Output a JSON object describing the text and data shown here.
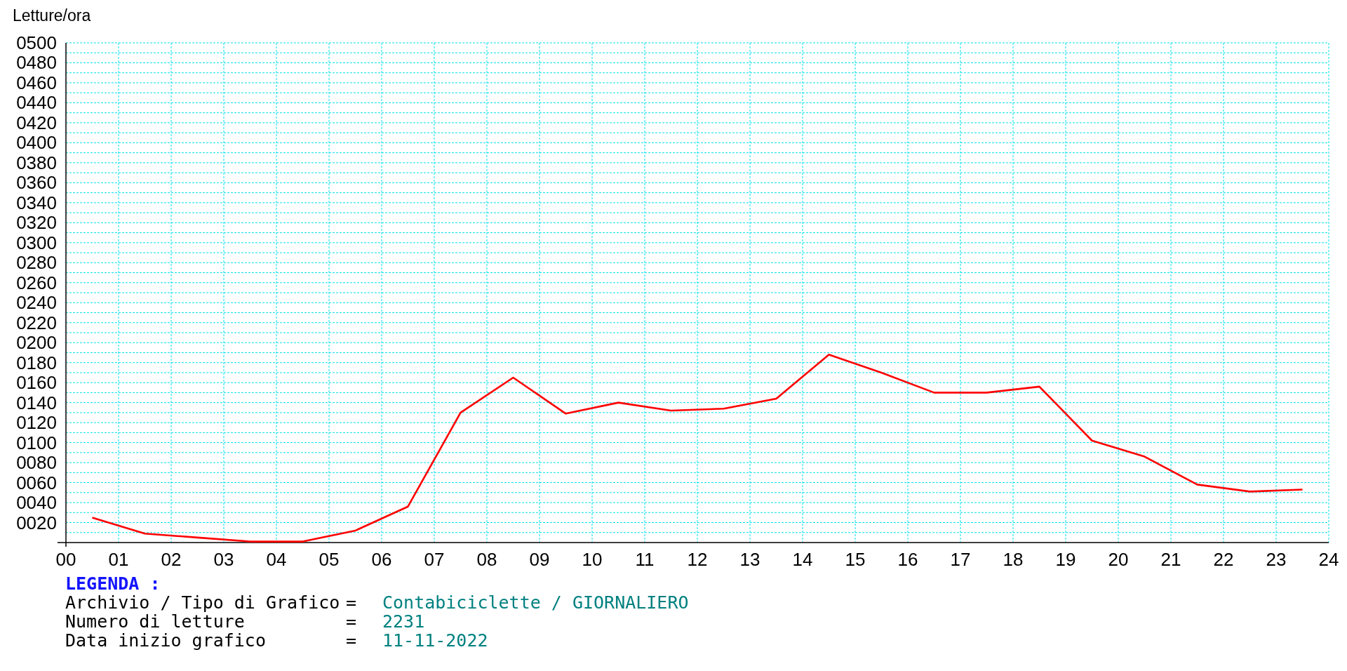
{
  "chart": {
    "chart_data": {
      "type": "line",
      "grid": true,
      "ylabel": "Letture/ora",
      "x": [
        0.5,
        1.5,
        2.5,
        3.5,
        4.5,
        5.5,
        6.5,
        7.5,
        8.5,
        9.5,
        10.5,
        11.5,
        12.5,
        13.5,
        14.5,
        15.5,
        16.5,
        17.5,
        18.5,
        19.5,
        20.5,
        21.5,
        22.5,
        23.5
      ],
      "series": [
        {
          "color": "#ff0000",
          "values": [
            25,
            9,
            5,
            1,
            1,
            12,
            36,
            130,
            165,
            129,
            140,
            132,
            134,
            144,
            188,
            170,
            150,
            150,
            156,
            102,
            86,
            58,
            51,
            53
          ]
        }
      ],
      "xlim": [
        0,
        24
      ],
      "ylim": [
        0,
        500
      ],
      "xticks": [
        {
          "value": 0,
          "label": "00"
        },
        {
          "value": 1,
          "label": "01"
        },
        {
          "value": 2,
          "label": "02"
        },
        {
          "value": 3,
          "label": "03"
        },
        {
          "value": 4,
          "label": "04"
        },
        {
          "value": 5,
          "label": "05"
        },
        {
          "value": 6,
          "label": "06"
        },
        {
          "value": 7,
          "label": "07"
        },
        {
          "value": 8,
          "label": "08"
        },
        {
          "value": 9,
          "label": "09"
        },
        {
          "value": 10,
          "label": "10"
        },
        {
          "value": 11,
          "label": "11"
        },
        {
          "value": 12,
          "label": "12"
        },
        {
          "value": 13,
          "label": "13"
        },
        {
          "value": 14,
          "label": "14"
        },
        {
          "value": 15,
          "label": "15"
        },
        {
          "value": 16,
          "label": "16"
        },
        {
          "value": 17,
          "label": "17"
        },
        {
          "value": 18,
          "label": "18"
        },
        {
          "value": 19,
          "label": "19"
        },
        {
          "value": 20,
          "label": "20"
        },
        {
          "value": 21,
          "label": "21"
        },
        {
          "value": 22,
          "label": "22"
        },
        {
          "value": 23,
          "label": "23"
        },
        {
          "value": 24,
          "label": "24"
        }
      ],
      "yticks": [
        {
          "value": 20,
          "label": "0020"
        },
        {
          "value": 40,
          "label": "0040"
        },
        {
          "value": 60,
          "label": "0060"
        },
        {
          "value": 80,
          "label": "0080"
        },
        {
          "value": 100,
          "label": "0100"
        },
        {
          "value": 120,
          "label": "0120"
        },
        {
          "value": 140,
          "label": "0140"
        },
        {
          "value": 160,
          "label": "0160"
        },
        {
          "value": 180,
          "label": "0180"
        },
        {
          "value": 200,
          "label": "0200"
        },
        {
          "value": 220,
          "label": "0220"
        },
        {
          "value": 240,
          "label": "0240"
        },
        {
          "value": 260,
          "label": "0260"
        },
        {
          "value": 280,
          "label": "0280"
        },
        {
          "value": 300,
          "label": "0300"
        },
        {
          "value": 320,
          "label": "0320"
        },
        {
          "value": 340,
          "label": "0340"
        },
        {
          "value": 360,
          "label": "0360"
        },
        {
          "value": 380,
          "label": "0380"
        },
        {
          "value": 400,
          "label": "0400"
        },
        {
          "value": 420,
          "label": "0420"
        },
        {
          "value": 440,
          "label": "0440"
        },
        {
          "value": 460,
          "label": "0460"
        },
        {
          "value": 480,
          "label": "0480"
        },
        {
          "value": 500,
          "label": "0500"
        }
      ]
    }
  },
  "legend": {
    "title": "LEGENDA :",
    "rows": [
      {
        "label": "Archivio / Tipo di Grafico",
        "separator": "=",
        "value": "Contabiciclette / GIORNALIERO"
      },
      {
        "label": "Numero di letture",
        "separator": "=",
        "value": "2231"
      },
      {
        "label": "Data inizio grafico",
        "separator": "=",
        "value": "11-11-2022"
      }
    ]
  }
}
